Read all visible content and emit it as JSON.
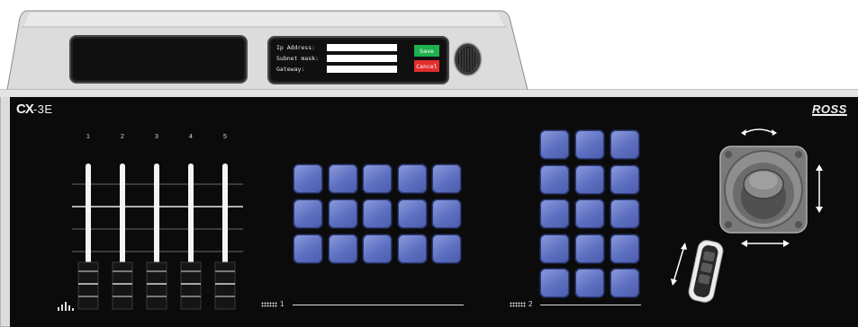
{
  "network": {
    "ip_label": "Ip Address:",
    "subnet_label": "Subnet mask:",
    "gateway_label": "Gateway:",
    "ip_value": "",
    "subnet_value": "",
    "gateway_value": "",
    "save_label": "Save",
    "cancel_label": "Cancel"
  },
  "brand": {
    "model_prefix": "CX",
    "model_suffix": "-3E",
    "maker": "ROSS"
  },
  "faders": {
    "labels": [
      "1",
      "2",
      "3",
      "4",
      "5"
    ],
    "levels": [
      0.72,
      0.72,
      0.72,
      0.72,
      0.72
    ]
  },
  "groups": {
    "group1_label": "1",
    "group2_label": "2"
  },
  "colors": {
    "key_blue": "#6c7ccc",
    "save_green": "#1fb050",
    "cancel_red": "#e22d2d",
    "panel_black": "#0b0b0b"
  },
  "icons": [
    "level-meter-icon",
    "grid-icon",
    "rotate-arrows-icon",
    "vertical-arrows-icon",
    "horizontal-arrows-icon",
    "zoom-arrows-icon"
  ]
}
